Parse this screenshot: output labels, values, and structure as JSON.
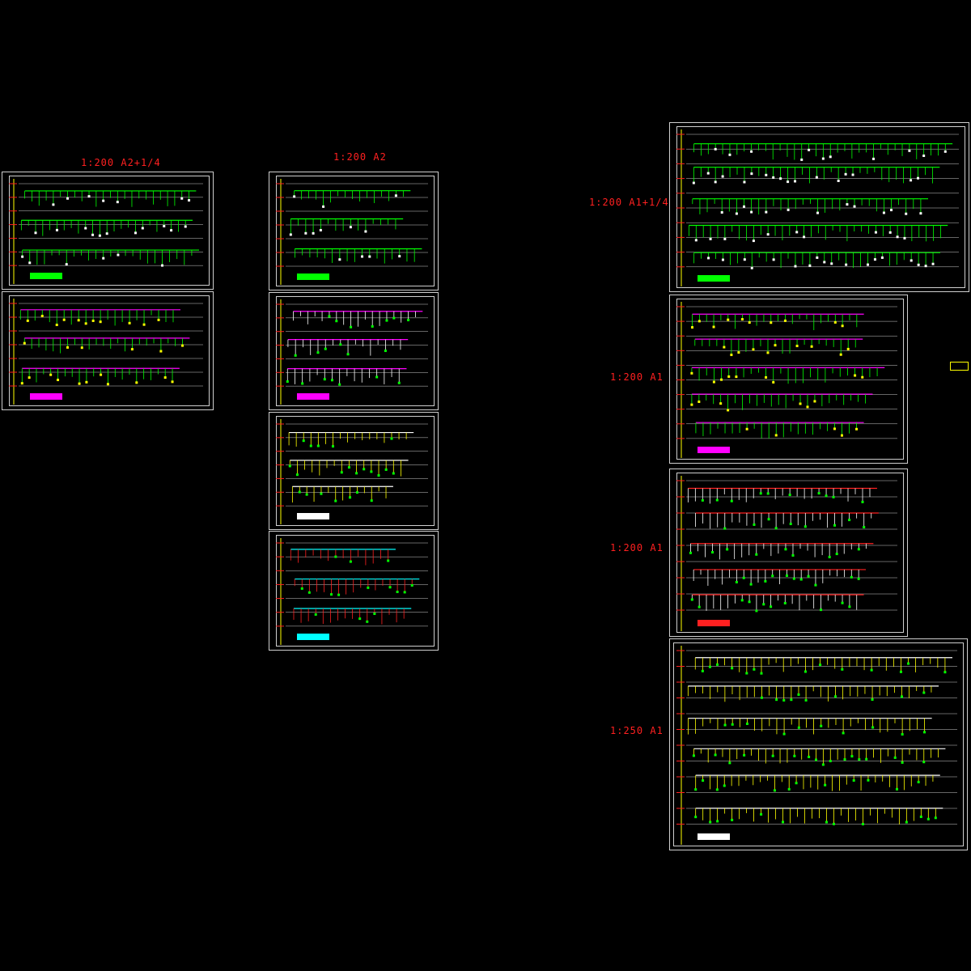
{
  "scale_labels": {
    "left_column": "1:200  A2+1/4",
    "middle_column": "1:200  A2",
    "right_sheet_1": "1:200  A1+1/4",
    "right_sheet_2": "1:200  A1",
    "right_sheet_3": "1:200  A1",
    "right_sheet_4": "1:250  A1"
  },
  "colors": {
    "label": "#ff2020",
    "frame": "#cfcfcf",
    "pipe_green": "#00ff00",
    "pipe_magenta": "#ff00ff",
    "pipe_red": "#ff2020",
    "pipe_yellow": "#ffff00",
    "pipe_cyan": "#00ffff",
    "pipe_white": "#ffffff"
  },
  "sheets": [
    {
      "id": "left-1",
      "theme": "green"
    },
    {
      "id": "left-2",
      "theme": "magenta-green"
    },
    {
      "id": "mid-1",
      "theme": "green"
    },
    {
      "id": "mid-2",
      "theme": "magenta-white"
    },
    {
      "id": "mid-3",
      "theme": "white-yellow"
    },
    {
      "id": "mid-4",
      "theme": "cyan-red"
    },
    {
      "id": "right-1",
      "theme": "green"
    },
    {
      "id": "right-2",
      "theme": "magenta-green"
    },
    {
      "id": "right-3",
      "theme": "red"
    },
    {
      "id": "right-4",
      "theme": "white-yellow"
    }
  ]
}
